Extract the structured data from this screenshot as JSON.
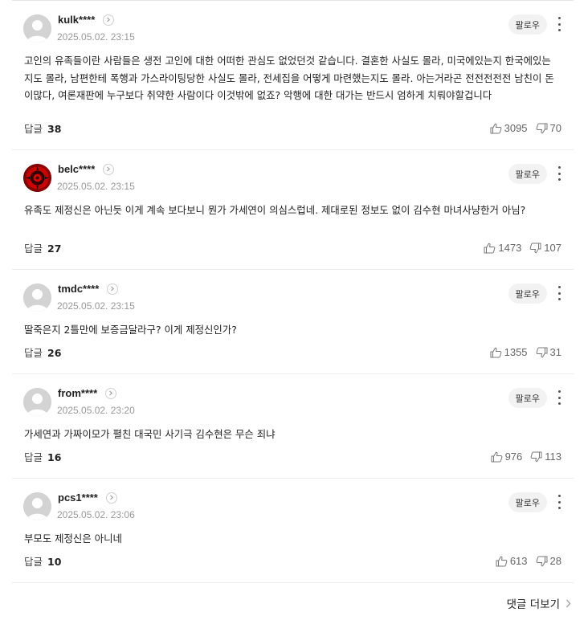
{
  "follow_label": "팔로우",
  "reply_label": "답글",
  "more_comments_label": "댓글 더보기",
  "comments": [
    {
      "nickname": "kulk****",
      "date": "2025.05.02. 23:15",
      "text": "고인의 유족들이란 사람들은 생전 고인에 대한 어떠한 관심도 없었던것 같습니다. 결혼한 사실도 몰라, 미국에있는지 한국에있는지도 몰라, 남편한테 폭행과 가스라이팅당한 사실도 몰라, 전세집을 어떻게 마련했는지도 몰라. 아는거라곤 전전전전전 남친이 돈이많다, 여론재판에 누구보다 취약한 사람이다 이것밖에 없죠? 악행에 대한 대가는 반드시 엄하게 치뤄야할겁니다",
      "replies": "38",
      "likes": "3095",
      "dislikes": "70",
      "avatar": "default"
    },
    {
      "nickname": "belc****",
      "date": "2025.05.02. 23:15",
      "text": "유족도 제정신은 아닌듯 이게 계속 보다보니 뭔가 가세연이 의심스럽네. 제대로된 정보도 없이 김수현 마녀사냥한거 아님?",
      "replies": "27",
      "likes": "1473",
      "dislikes": "107",
      "avatar": "custom"
    },
    {
      "nickname": "tmdc****",
      "date": "2025.05.02. 23:15",
      "text": "딸죽은지 2틀만에 보증금달라구? 이게 제정신인가?",
      "replies": "26",
      "likes": "1355",
      "dislikes": "31",
      "avatar": "default"
    },
    {
      "nickname": "from****",
      "date": "2025.05.02. 23:20",
      "text": "가세연과 가짜이모가 펼친 대국민 사기극 김수현은 무슨 죄냐",
      "replies": "16",
      "likes": "976",
      "dislikes": "113",
      "avatar": "default"
    },
    {
      "nickname": "pcs1****",
      "date": "2025.05.02. 23:06",
      "text": "부모도 제정신은 아니네",
      "replies": "10",
      "likes": "613",
      "dislikes": "28",
      "avatar": "default"
    }
  ]
}
